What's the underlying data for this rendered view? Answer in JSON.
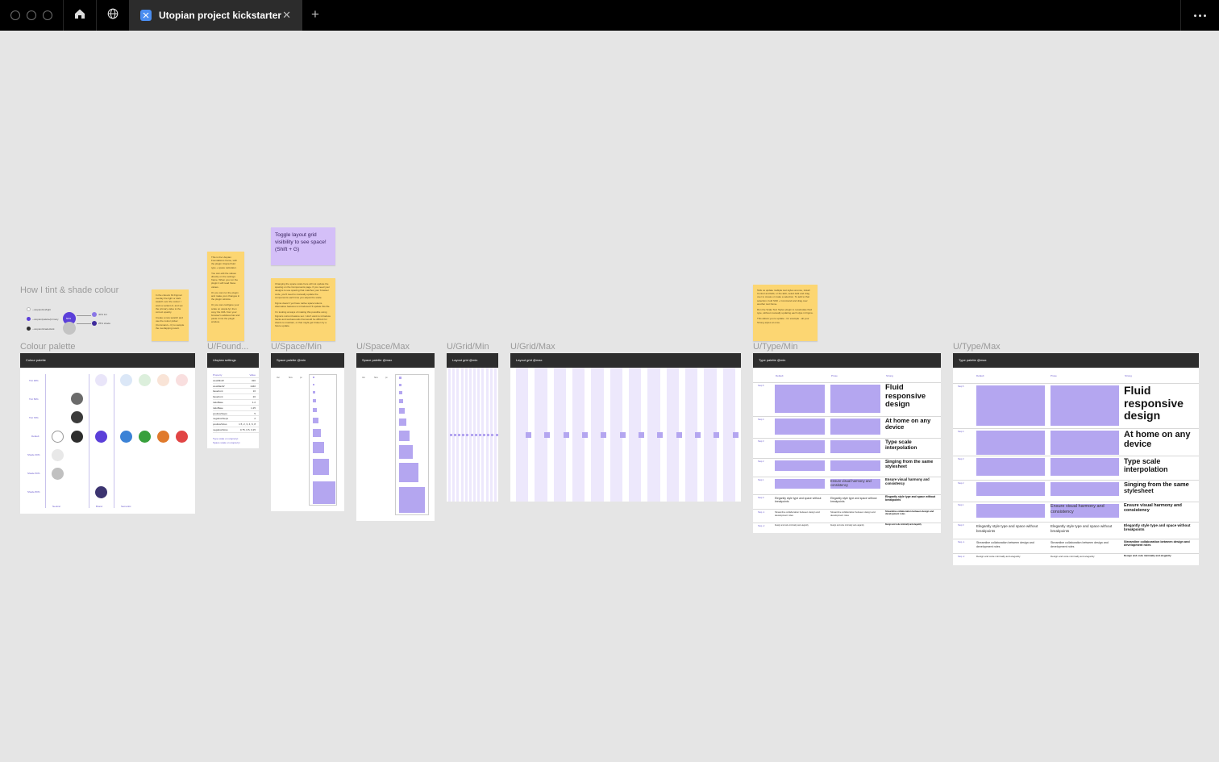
{
  "titlebar": {
    "home_icon": "home-icon",
    "community_icon": "globe-icon",
    "tab_title": "Utopian project kickstarter",
    "close": "✕",
    "new_tab": "+"
  },
  "canvas": {
    "tint_title": "How I tint & shade colour",
    "tint_items": [
      "--utopian/tint/light",
      "--utopian/palette/primary",
      "--utopian/shade/dark"
    ],
    "tint_center": "50%",
    "tint_right": [
      "40% tint",
      "25% shade"
    ],
    "frames": {
      "colour_palette": {
        "label": "Colour palette",
        "header": "Colour palette"
      },
      "foundations": {
        "label": "U/Found...",
        "header": "Utopian settings"
      },
      "space_min": {
        "label": "U/Space/Min",
        "header": "Space palette @min"
      },
      "space_max": {
        "label": "U/Space/Max",
        "header": "Space palette @max"
      },
      "grid_min": {
        "label": "U/Grid/Min",
        "header": "Layout grid @min"
      },
      "grid_max": {
        "label": "U/Grid/Max",
        "header": "Layout grid @max"
      },
      "type_min": {
        "label": "U/Type/Min",
        "header": "Type palette @min"
      },
      "type_max": {
        "label": "U/Type/Max",
        "header": "Type palette @max"
      }
    },
    "palette": {
      "row_labels": [
        "Tint 30%",
        "Tint 50%",
        "Tint 70%",
        "Default",
        "Shade 30%",
        "Shade 50%",
        "Shade 80%"
      ],
      "col_labels": [
        "Neutral",
        "Brand",
        "Semantic"
      ],
      "colors": {
        "brand": "#5b3fd9",
        "dark": "#2d2d2d",
        "blue": "#3b82d6",
        "green": "#38a03c",
        "orange": "#e07a2c",
        "red": "#e14545",
        "navy": "#3c3470"
      }
    },
    "settings_rows": [
      [
        "Property",
        "Value"
      ],
      [
        "viewMinW",
        "320"
      ],
      [
        "viewMaxW",
        "1440"
      ],
      [
        "baseFont",
        "16"
      ],
      [
        "baseFont",
        "20"
      ],
      [
        "ratioBase",
        "1.2"
      ],
      [
        "ratioBase",
        "1.25"
      ],
      [
        "positiveSteps",
        "5"
      ],
      [
        "negativeSteps",
        "2"
      ],
      [
        "positiveSizes",
        "1.5, 2, 3, 4, 6, 8"
      ],
      [
        "negativeSizes",
        "0.75, 0.5, 0.25"
      ]
    ],
    "settings_links": [
      "Type scale on utopia.fyi",
      "Space scale on utopia.fyi"
    ],
    "space_min_headers": [
      "Var",
      "Size",
      "px"
    ],
    "space_max_headers": [
      "Var",
      "Size",
      "px"
    ],
    "type_columns": [
      "Default",
      "Prose",
      "Strong"
    ],
    "type_min_steps": [
      "Step 5",
      "Step 4",
      "Step 3",
      "Step 2",
      "Step 1",
      "Step 0",
      "Step -1",
      "Step -2"
    ],
    "type_max_steps": [
      "Step 5",
      "Step 4",
      "Step 3",
      "Step 2",
      "Step 1",
      "Step 0",
      "Step -1",
      "Step -2"
    ],
    "type_strong": [
      "Fluid responsive design",
      "At home on any device",
      "Type scale interpolation",
      "Singing from the same stylesheet",
      "Ensure visual harmony and consistency",
      "Elegantly style type and space without breakpoints",
      "Streamline collaboration between design and development roles",
      "Design and code minimally and elegantly"
    ],
    "type_prose": [
      "Ensure visual harmony and consistency",
      "Elegantly style type and space without breakpoints",
      "Streamline collaboration between design and development roles",
      "Design and code minimally and elegantly"
    ],
    "sticky_notes": {
      "palette_note": [
        "In the colours Kit Figma I overlay the light or dark swatch over the colour I want a variant of, and set the primary value to the correct opacity.",
        "Create a new swatch and use the colour picker (Command + C) to sample the overlapping result."
      ],
      "settings_note": [
        "This is the Utopian Foundations frame, with the plugin Utopia Fluid type + space calculator.",
        "You can edit the values directly on the settings frame. When you run the plugin it will read these values.",
        "Or you can run the plugin and make your changes in the plugin window.",
        "Or you can configure your scale on utopia.fyi, then copy the URL from your browser's address bar and paste it into the plugin window."
      ],
      "toggle_note": "Toggle layout grid visibility to see space! (Shift + G)",
      "space_note": [
        "Changing the space scale here will not update the spacing on the Components page. If you need your designs to use spacing that matches your browser code, you'll need to manually update the components each time you adjust the scale.",
        "Figma doesn't yet have native space tokens. Alternative features is introduced I'll update this file.",
        "I'm looking at ways of making this possible using Figma's current feature set. I don't want to introduce hacks and workarounds that would be difficult for clients to maintain, or that might get broken by a future update."
      ],
      "type_note": [
        "Tells us update multiple text styles at once, install Control and Edit, or the Edit, select Edit and drag over to create or make a selection. To add to that selection, hold Shift + Command and drag over another text frame.",
        "Run the Scale Text Styles plugin to recalculate fluid type, without manually updating each style in Figma.",
        "This allows you to update - for example - all your Strong styles at once."
      ]
    }
  }
}
